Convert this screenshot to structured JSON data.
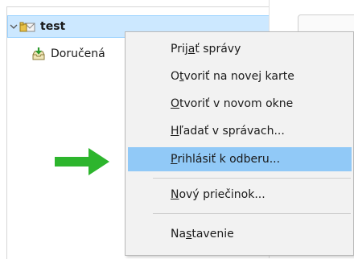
{
  "tree": {
    "account": {
      "label": "test",
      "icon": "mail-account-icon",
      "expander": "chevron-down-icon"
    },
    "inbox": {
      "label": "Doručená",
      "icon": "inbox-tray-icon"
    }
  },
  "context_menu": {
    "items": [
      {
        "pre": "Prij",
        "key": "a",
        "post": "ť správy"
      },
      {
        "pre": "O",
        "key": "t",
        "post": "voriť na novej karte"
      },
      {
        "pre": "",
        "key": "O",
        "post": "tvoriť v novom okne"
      },
      {
        "pre": "",
        "key": "H",
        "post": "ľadať v správach..."
      },
      {
        "pre": "",
        "key": "P",
        "post": "rihlásiť k odberu..."
      },
      {
        "pre": "",
        "key": "N",
        "post": "ový priečinok..."
      },
      {
        "pre": "Na",
        "key": "s",
        "post": "tavenie"
      }
    ],
    "highlighted_index": 4
  },
  "annotation": {
    "arrow_icon": "right-arrow-icon",
    "arrow_color": "#2db52d"
  },
  "colors": {
    "selection": "#cce8ff",
    "menu_highlight": "#91c9f7",
    "menu_bg": "#f2f2f2"
  }
}
